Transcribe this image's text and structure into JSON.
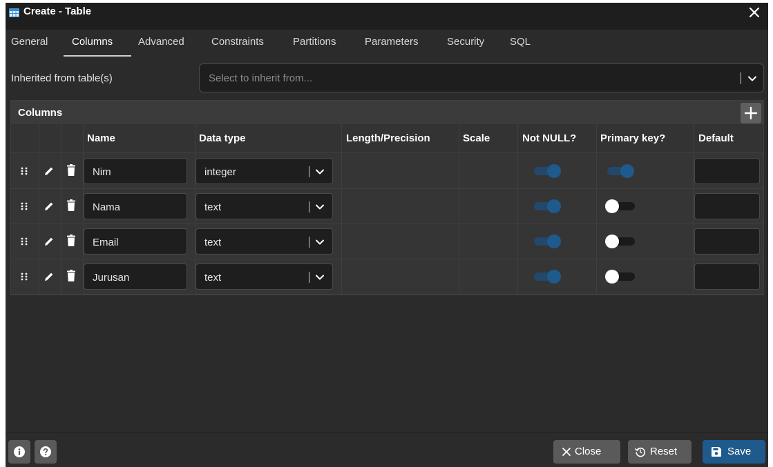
{
  "window": {
    "title": "Create - Table",
    "accent": "#1e5a8c"
  },
  "tabs": [
    {
      "label": "General",
      "active": false
    },
    {
      "label": "Columns",
      "active": true
    },
    {
      "label": "Advanced",
      "active": false
    },
    {
      "label": "Constraints",
      "active": false
    },
    {
      "label": "Partitions",
      "active": false
    },
    {
      "label": "Parameters",
      "active": false
    },
    {
      "label": "Security",
      "active": false
    },
    {
      "label": "SQL",
      "active": false
    }
  ],
  "inherit": {
    "label": "Inherited from table(s)",
    "placeholder": "Select to inherit from..."
  },
  "columns": {
    "title": "Columns",
    "headers": {
      "name": "Name",
      "data_type": "Data type",
      "length": "Length/Precision",
      "scale": "Scale",
      "not_null": "Not NULL?",
      "primary_key": "Primary key?",
      "default": "Default"
    },
    "rows": [
      {
        "name": "Nim",
        "data_type": "integer",
        "not_null": true,
        "primary_key": true,
        "default": ""
      },
      {
        "name": "Nama",
        "data_type": "text",
        "not_null": true,
        "primary_key": false,
        "default": ""
      },
      {
        "name": "Email",
        "data_type": "text",
        "not_null": true,
        "primary_key": false,
        "default": ""
      },
      {
        "name": "Jurusan",
        "data_type": "text",
        "not_null": true,
        "primary_key": false,
        "default": ""
      }
    ]
  },
  "footer": {
    "info_icon": "info-icon",
    "help_icon": "help-icon",
    "close_label": "Close",
    "reset_label": "Reset",
    "save_label": "Save"
  }
}
